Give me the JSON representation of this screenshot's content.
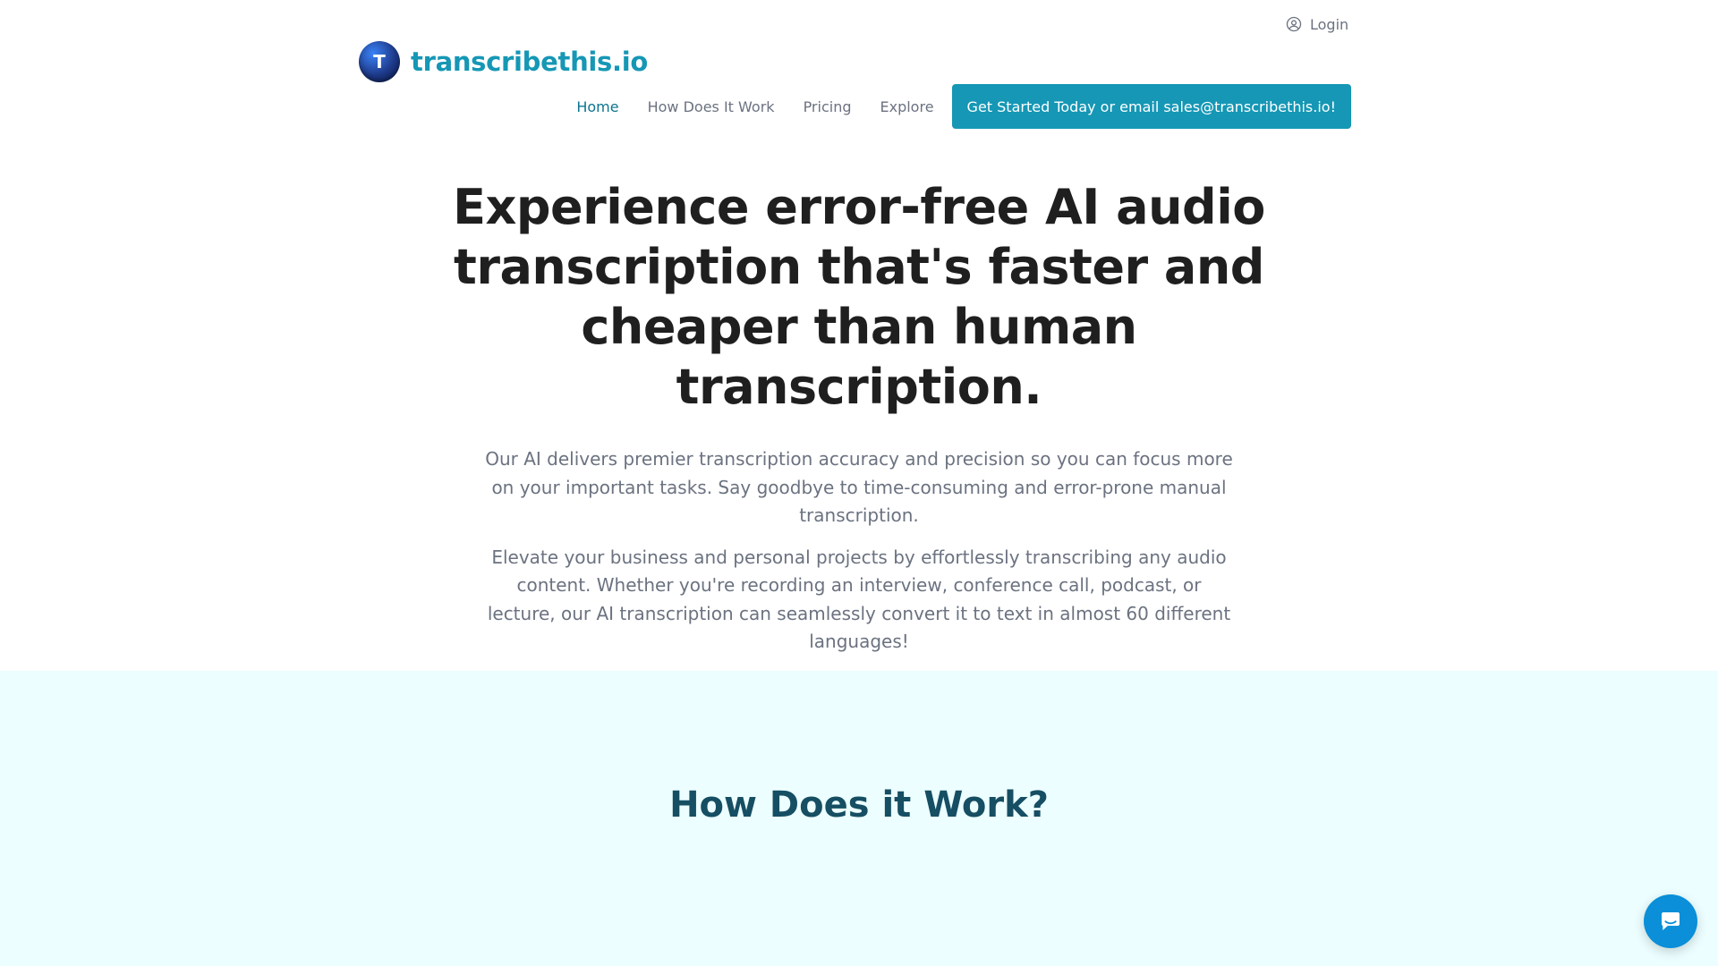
{
  "header": {
    "login_label": "Login",
    "logo_initial": "T",
    "logo_text": "transcribethis.io"
  },
  "nav": {
    "items": [
      {
        "label": "Home",
        "active": true
      },
      {
        "label": "How Does It Work",
        "active": false
      },
      {
        "label": "Pricing",
        "active": false
      },
      {
        "label": "Explore",
        "active": false
      }
    ],
    "cta_label": "Get Started Today or email sales@transcribethis.io!"
  },
  "hero": {
    "title": "Experience error-free AI audio transcription that's faster and cheaper than human transcription.",
    "paragraph_1": "Our AI delivers premier transcription accuracy and precision so you can focus more on your important tasks. Say goodbye to time-consuming and error-prone manual transcription.",
    "paragraph_2": "Elevate your business and personal projects by effortlessly transcribing any audio content. Whether you're recording an interview, conference call, podcast, or lecture, our AI transcription can seamlessly convert it to text in almost 60 different languages!"
  },
  "how_section": {
    "title": "How Does it Work?"
  },
  "icons": {
    "login": "user-circle-icon",
    "chat": "chat-bubble-icon"
  },
  "colors": {
    "brand": "#1597b5",
    "nav_active": "#0e7490",
    "section_bg": "#ecfeff",
    "section_heading": "#164e63",
    "chat_button": "#0a8fd8"
  }
}
